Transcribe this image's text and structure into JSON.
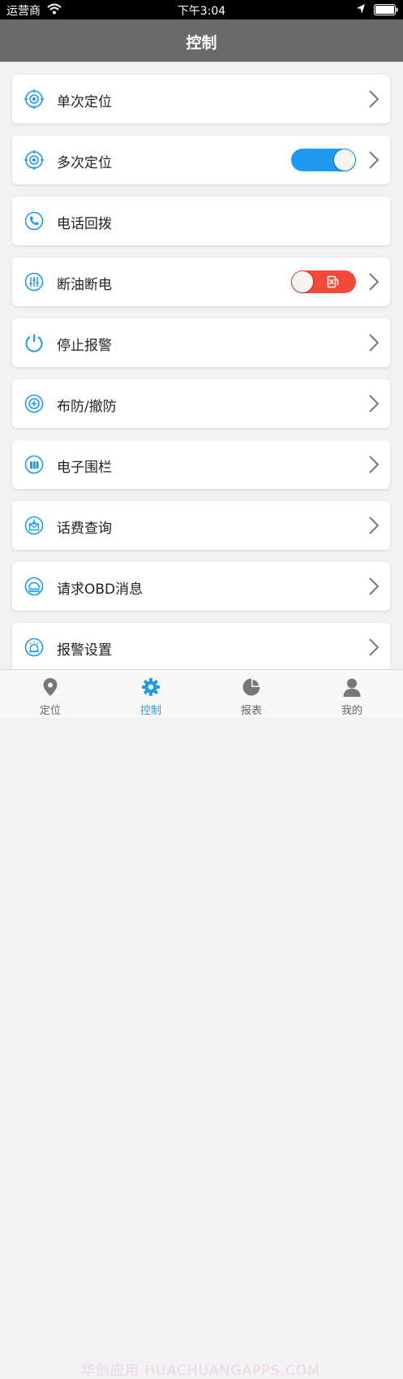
{
  "status_bar": {
    "carrier": "运营商",
    "time": "下午3:04"
  },
  "header": {
    "title": "控制"
  },
  "rows": [
    {
      "label": "单次定位",
      "icon": "target-icon",
      "has_chevron": true
    },
    {
      "label": "多次定位",
      "icon": "target-icon",
      "has_chevron": true,
      "toggle": "on"
    },
    {
      "label": "电话回拨",
      "icon": "phone-icon",
      "has_chevron": false
    },
    {
      "label": "断油断电",
      "icon": "sliders-icon",
      "has_chevron": true,
      "toggle": "off"
    },
    {
      "label": "停止报警",
      "icon": "power-icon",
      "has_chevron": true
    },
    {
      "label": "布防/撤防",
      "icon": "shield-plus-icon",
      "has_chevron": true
    },
    {
      "label": "电子围栏",
      "icon": "fence-icon",
      "has_chevron": true
    },
    {
      "label": "话费查询",
      "icon": "mail-icon",
      "has_chevron": true
    },
    {
      "label": "请求OBD消息",
      "icon": "gauge-icon",
      "has_chevron": true
    },
    {
      "label": "报警设置",
      "icon": "alarm-icon",
      "has_chevron": true
    }
  ],
  "tabs": [
    {
      "label": "定位",
      "icon": "location-pin-icon"
    },
    {
      "label": "控制",
      "icon": "gear-icon",
      "active": true
    },
    {
      "label": "报表",
      "icon": "pie-chart-icon"
    },
    {
      "label": "我的",
      "icon": "user-icon"
    }
  ],
  "watermark": "华创应用 HUACHUANGAPPS.COM",
  "colors": {
    "accent": "#1e9bf0",
    "danger": "#f24a3a",
    "navbar": "#6a6a6a"
  }
}
